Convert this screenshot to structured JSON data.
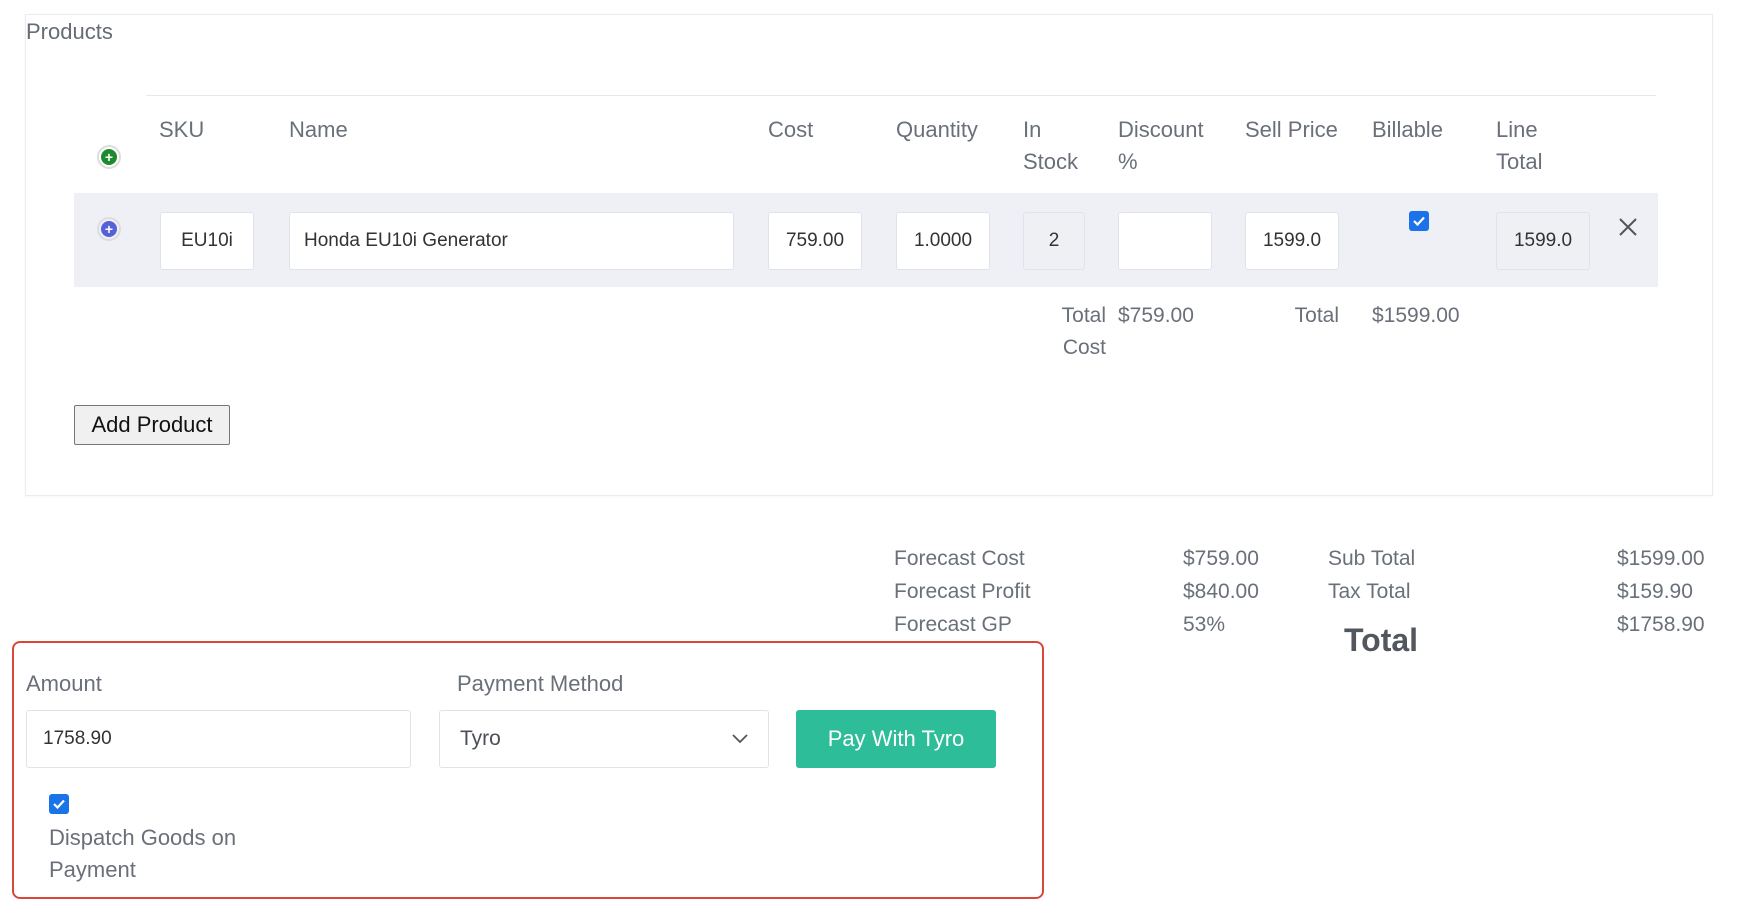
{
  "products": {
    "title": "Products",
    "columns": {
      "sku": "SKU",
      "name": "Name",
      "cost": "Cost",
      "quantity": "Quantity",
      "in_stock": [
        "In",
        "Stock"
      ],
      "discount": [
        "Discount",
        "%"
      ],
      "sell_price": "Sell Price",
      "billable": "Billable",
      "line_total": [
        "Line",
        "Total"
      ]
    },
    "rows": [
      {
        "sku": "EU10i",
        "name": "Honda EU10i Generator",
        "cost": "759.00",
        "quantity": "1.0000",
        "in_stock": "2",
        "discount": "",
        "sell_price": "1599.0",
        "billable": true,
        "line_total": "1599.0"
      }
    ],
    "totals": {
      "total_cost_label": [
        "Total",
        "Cost"
      ],
      "total_cost_value": "$759.00",
      "total_label": "Total",
      "total_value": "$1599.00"
    },
    "add_product_label": "Add Product"
  },
  "summary": {
    "forecast_cost_label": "Forecast Cost",
    "forecast_cost_value": "$759.00",
    "forecast_profit_label": "Forecast Profit",
    "forecast_profit_value": "$840.00",
    "forecast_gp_label": "Forecast GP",
    "forecast_gp_value": "53%",
    "sub_total_label": "Sub Total",
    "sub_total_value": "$1599.00",
    "tax_total_label": "Tax Total",
    "tax_total_value": "$159.90",
    "total_label": "Total",
    "total_value": "$1758.90"
  },
  "payment": {
    "amount_label": "Amount",
    "amount_value": "1758.90",
    "method_label": "Payment Method",
    "method_value": "Tyro",
    "pay_button_label": "Pay With Tyro",
    "dispatch_checked": true,
    "dispatch_label": [
      "Dispatch Goods on",
      "Payment"
    ]
  },
  "colors": {
    "accent": "#2dbd98",
    "highlight_border": "#d9463a",
    "add_row_icon": "#1e8a2e",
    "row_menu_icon": "#5660d8",
    "checkbox": "#1a73e8"
  },
  "icons": [
    "plus-circle-icon",
    "plus-circle-icon",
    "close-icon",
    "chevron-down-icon",
    "check-icon"
  ]
}
